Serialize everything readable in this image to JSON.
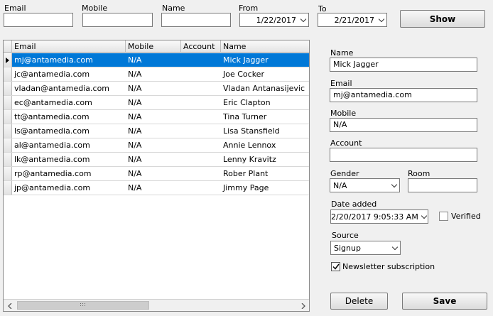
{
  "filters": {
    "email_label": "Email",
    "mobile_label": "Mobile",
    "name_label": "Name",
    "from_label": "From",
    "from_value": "1/22/2017",
    "to_label": "To",
    "to_value": "2/21/2017",
    "show_label": "Show"
  },
  "grid": {
    "columns": [
      "Email",
      "Mobile",
      "Account",
      "Name"
    ],
    "rows": [
      {
        "email": "mj@antamedia.com",
        "mobile": "N/A",
        "account": "",
        "name": "Mick Jagger"
      },
      {
        "email": "jc@antamedia.com",
        "mobile": "N/A",
        "account": "",
        "name": "Joe Cocker"
      },
      {
        "email": "vladan@antamedia.com",
        "mobile": "N/A",
        "account": "",
        "name": "Vladan Antanasijevic"
      },
      {
        "email": "ec@antamedia.com",
        "mobile": "N/A",
        "account": "",
        "name": "Eric Clapton"
      },
      {
        "email": "tt@antamedia.com",
        "mobile": "N/A",
        "account": "",
        "name": "Tina Turner"
      },
      {
        "email": "ls@antamedia.com",
        "mobile": "N/A",
        "account": "",
        "name": "Lisa Stansfield"
      },
      {
        "email": "al@antamedia.com",
        "mobile": "N/A",
        "account": "",
        "name": "Annie Lennox"
      },
      {
        "email": "lk@antamedia.com",
        "mobile": "N/A",
        "account": "",
        "name": "Lenny Kravitz"
      },
      {
        "email": "rp@antamedia.com",
        "mobile": "N/A",
        "account": "",
        "name": "Rober Plant"
      },
      {
        "email": "jp@antamedia.com",
        "mobile": "N/A",
        "account": "",
        "name": "Jimmy Page"
      }
    ]
  },
  "details": {
    "name_label": "Name",
    "name_value": "Mick Jagger",
    "email_label": "Email",
    "email_value": "mj@antamedia.com",
    "mobile_label": "Mobile",
    "mobile_value": "N/A",
    "account_label": "Account",
    "account_value": "",
    "gender_label": "Gender",
    "gender_value": "N/A",
    "room_label": "Room",
    "room_value": "",
    "date_added_label": "Date added",
    "date_added_value": "2/20/2017 9:05:33 AM",
    "verified_label": "Verified",
    "verified_checked": false,
    "source_label": "Source",
    "source_value": "Signup",
    "newsletter_label": "Newsletter subscription",
    "newsletter_checked": true,
    "delete_label": "Delete",
    "save_label": "Save"
  },
  "colors": {
    "selection": "#0078d7",
    "background": "#f0f0f0"
  }
}
